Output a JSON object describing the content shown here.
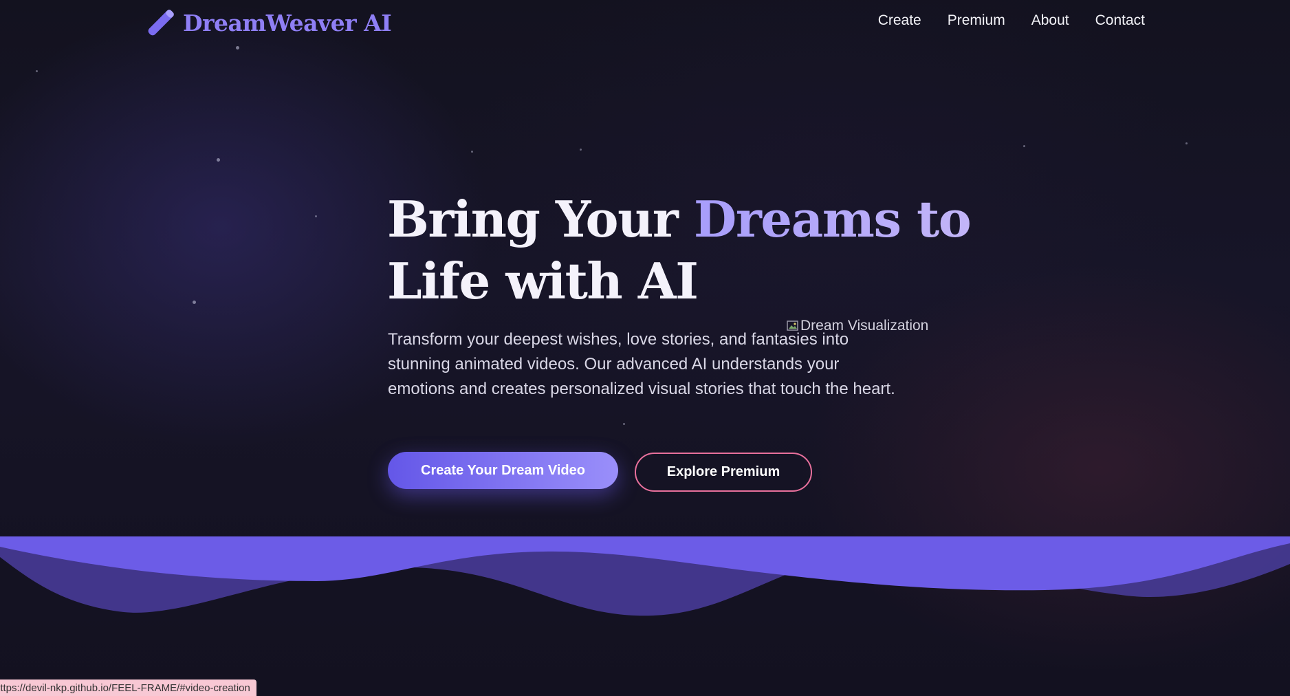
{
  "app": {
    "brand_name": "DreamWeaver AI",
    "brand_icon": "magic-wand-icon",
    "brand_color": "#8f7ff5"
  },
  "nav": {
    "links": [
      {
        "label": "Create"
      },
      {
        "label": "Premium"
      },
      {
        "label": "About"
      },
      {
        "label": "Contact"
      }
    ]
  },
  "hero": {
    "title_part1": "Bring Your ",
    "title_accent": "Dreams to",
    "title_part2": "Life with AI",
    "description": "Transform your deepest wishes, love stories, and fantasies into stunning animated videos. Our advanced AI understands your emotions and creates personalized visual stories that touch the heart.",
    "image_alt": "Dream Visualization",
    "primary_button": "Create Your Dream Video",
    "secondary_button": "Explore Premium"
  },
  "colors": {
    "accent": "#6c5ce7",
    "accent_light": "#a79dfb",
    "secondary_border": "#e8709c",
    "background": "#100f1c"
  },
  "status_bar": {
    "url": "https://devil-nkp.github.io/FEEL-FRAME/#video-creation"
  }
}
